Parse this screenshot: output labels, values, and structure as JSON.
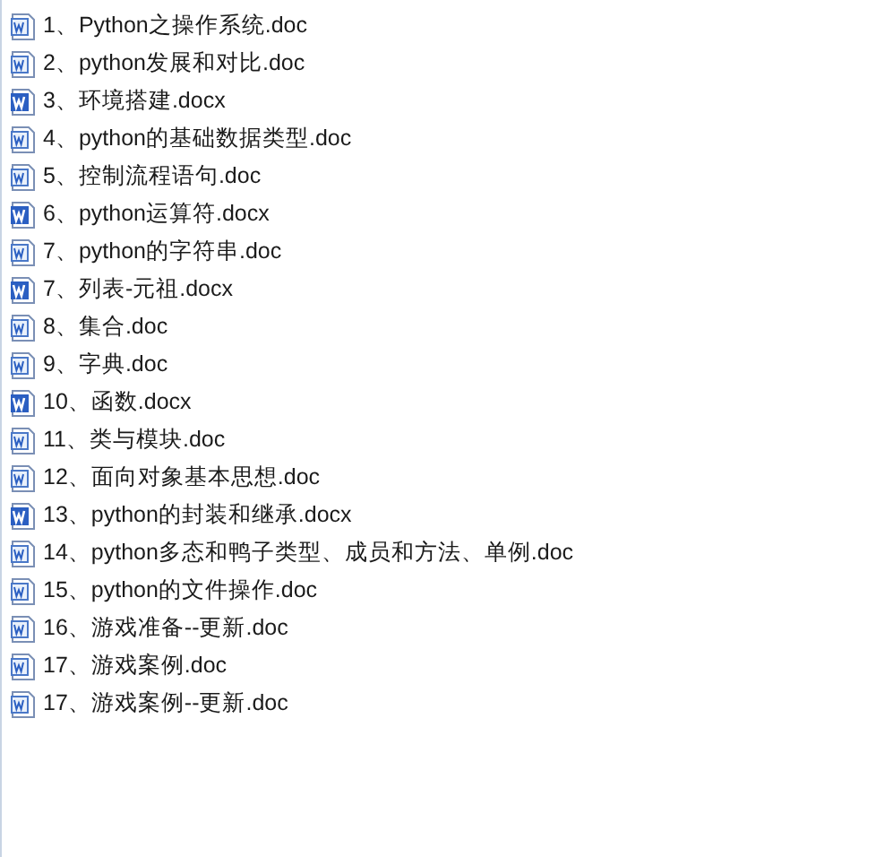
{
  "files": [
    {
      "name": "1、Python之操作系统.doc",
      "kind": "doc"
    },
    {
      "name": "2、python发展和对比.doc",
      "kind": "doc"
    },
    {
      "name": "3、环境搭建.docx",
      "kind": "docx"
    },
    {
      "name": "4、python的基础数据类型.doc",
      "kind": "doc"
    },
    {
      "name": "5、控制流程语句.doc",
      "kind": "doc"
    },
    {
      "name": "6、python运算符.docx",
      "kind": "docx"
    },
    {
      "name": "7、python的字符串.doc",
      "kind": "doc"
    },
    {
      "name": "7、列表-元祖.docx",
      "kind": "docx"
    },
    {
      "name": "8、集合.doc",
      "kind": "doc"
    },
    {
      "name": "9、字典.doc",
      "kind": "doc"
    },
    {
      "name": "10、函数.docx",
      "kind": "docx"
    },
    {
      "name": "11、类与模块.doc",
      "kind": "doc"
    },
    {
      "name": "12、面向对象基本思想.doc",
      "kind": "doc"
    },
    {
      "name": "13、python的封装和继承.docx",
      "kind": "docx"
    },
    {
      "name": "14、python多态和鸭子类型、成员和方法、单例.doc",
      "kind": "doc"
    },
    {
      "name": "15、python的文件操作.doc",
      "kind": "doc"
    },
    {
      "name": "16、游戏准备--更新.doc",
      "kind": "doc"
    },
    {
      "name": "17、游戏案例.doc",
      "kind": "doc"
    },
    {
      "name": "17、游戏案例--更新.doc",
      "kind": "doc"
    }
  ]
}
